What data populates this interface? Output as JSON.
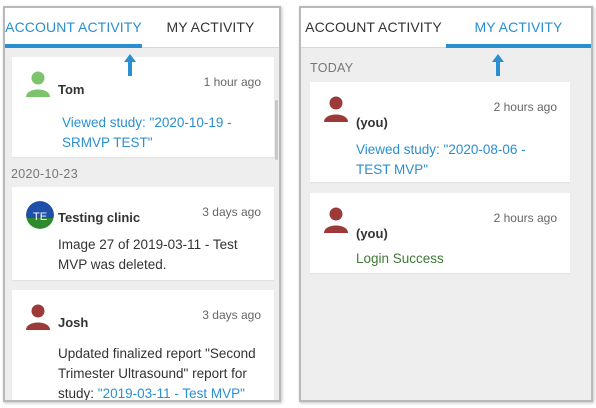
{
  "left_panel": {
    "tabs": [
      {
        "label": "ACCOUNT ACTIVITY",
        "active": true
      },
      {
        "label": "MY ACTIVITY",
        "active": false
      }
    ],
    "cards": [
      {
        "name": "Tom",
        "time": "1 hour ago",
        "body": "Viewed study: \"2020-10-19 - SRMVP TEST\"",
        "avatar": "person-icon-green"
      }
    ],
    "date_group": "2020-10-23",
    "cards_2": [
      {
        "name": "Testing clinic",
        "time": "3 days ago",
        "body": "Image 27 of 2019-03-11 - Test MVP was deleted.",
        "avatar_initials": "TE"
      },
      {
        "name": "Josh",
        "time": "3 days ago",
        "body_prefix": "Updated finalized report \"Second Trimester Ultrasound\" report for study: ",
        "body_link": "\"2019-03-11 - Test MVP\"",
        "avatar": "person-icon-maroon"
      }
    ]
  },
  "right_panel": {
    "tabs": [
      {
        "label": "ACCOUNT ACTIVITY",
        "active": false
      },
      {
        "label": "MY ACTIVITY",
        "active": true
      }
    ],
    "date_group": "TODAY",
    "cards": [
      {
        "name": "(you)",
        "time": "2 hours ago",
        "body": "Viewed study: \"2020-08-06 - TEST MVP\"",
        "avatar": "person-icon-maroon"
      },
      {
        "name": "(you)",
        "time": "2 hours ago",
        "body": "Login Success",
        "avatar": "person-icon-maroon"
      }
    ]
  },
  "colors": {
    "accent": "#2a8fd0",
    "success": "#3d7a36",
    "avatar_green": "#7cc36b",
    "avatar_maroon": "#9c3a3a"
  }
}
